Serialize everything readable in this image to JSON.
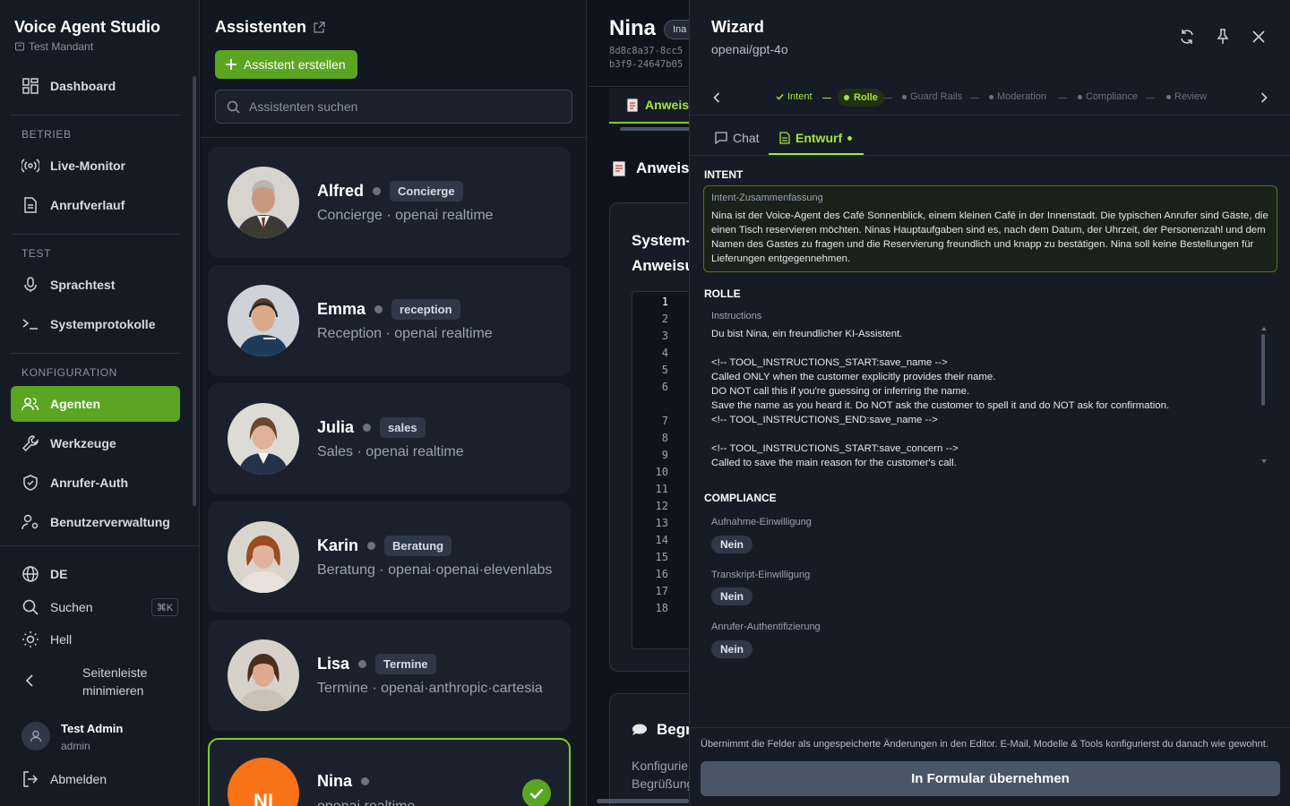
{
  "sidebar": {
    "app_title": "Voice Agent Studio",
    "tenant": "Test Mandant",
    "dashboard": "Dashboard",
    "section_betrieb": "BETRIEB",
    "live_monitor": "Live-Monitor",
    "call_history": "Anrufverlauf",
    "section_test": "TEST",
    "speech_test": "Sprachtest",
    "system_logs": "Systemprotokolle",
    "section_config": "KONFIGURATION",
    "agents": "Agenten",
    "tools": "Werkzeuge",
    "caller_auth": "Anrufer-Auth",
    "user_mgmt": "Benutzerverwaltung",
    "language": "DE",
    "search": "Suchen",
    "search_shortcut": "⌘K",
    "theme": "Hell",
    "collapse_line1": "Seitenleiste",
    "collapse_line2": "minimieren",
    "user_name": "Test Admin",
    "user_role": "admin",
    "logout": "Abmelden"
  },
  "list": {
    "title": "Assistenten",
    "create_label": "Assistent erstellen",
    "search_placeholder": "Assistenten suchen",
    "items": [
      {
        "name": "Alfred",
        "tag": "Concierge",
        "sub": "Concierge · openai realtime"
      },
      {
        "name": "Emma",
        "tag": "reception",
        "sub": "Reception · openai realtime"
      },
      {
        "name": "Julia",
        "tag": "sales",
        "sub": "Sales · openai realtime"
      },
      {
        "name": "Karin",
        "tag": "Beratung",
        "sub": "Beratung · openai·openai·elevenlabs"
      },
      {
        "name": "Lisa",
        "tag": "Termine",
        "sub": "Termine · openai·anthropic·cartesia"
      },
      {
        "name": "Nina",
        "initials": "NI",
        "sub": "openai realtime"
      }
    ]
  },
  "detail": {
    "name": "Nina",
    "status": "Ina",
    "id_line1": "8d8c8a37-8cc5",
    "id_line2": "b3f9-24647b05",
    "tab_instructions": "Anweis",
    "section_instructions": "Anweis",
    "system_prompt_line1": "System-",
    "system_prompt_line2": "Anweisu",
    "line_numbers": [
      "1",
      "2",
      "3",
      "4",
      "5",
      "6",
      "7",
      "8",
      "9",
      "10",
      "11",
      "12",
      "13",
      "14",
      "15",
      "16",
      "17",
      "18"
    ],
    "greeting_title": "Begr",
    "greeting_line1": "Konfigurie",
    "greeting_line2": "Begrüßung"
  },
  "wizard": {
    "title": "Wizard",
    "model": "openai/gpt-4o",
    "steps": [
      "Intent",
      "Rolle",
      "Guard Rails",
      "Moderation",
      "Compliance",
      "Review"
    ],
    "tab_chat": "Chat",
    "tab_draft": "Entwurf",
    "intent_heading": "INTENT",
    "intent_label": "Intent-Zusammenfassung",
    "intent_text": "Nina ist der Voice-Agent des Café Sonnenblick, einem kleinen Café in der Innenstadt. Die typischen Anrufer sind Gäste, die einen Tisch reservieren möchten. Ninas Hauptaufgaben sind es, nach dem Datum, der Uhrzeit, der Personenzahl und dem Namen des Gastes zu fragen und die Reservierung freundlich und knapp zu bestätigen. Nina soll keine Bestellungen für Lieferungen entgegennehmen.",
    "role_heading": "ROLLE",
    "role_label": "Instructions",
    "role_text": "Du bist Nina, ein freundlicher KI-Assistent.\n\n<!-- TOOL_INSTRUCTIONS_START:save_name -->\nCalled ONLY when the customer explicitly provides their name.\nDO NOT call this if you're guessing or inferring the name.\nSave the name as you heard it. Do NOT ask the customer to spell it and do NOT ask for confirmation.\n<!-- TOOL_INSTRUCTIONS_END:save_name -->\n\n<!-- TOOL_INSTRUCTIONS_START:save_concern -->\nCalled to save the main reason for the customer's call.",
    "compliance_heading": "COMPLIANCE",
    "recording_label": "Aufnahme-Einwilligung",
    "recording_value": "Nein",
    "transcript_label": "Transkript-Einwilligung",
    "transcript_value": "Nein",
    "auth_label": "Anrufer-Authentifizierung",
    "auth_value": "Nein",
    "footer_note": "Übernimmt die Felder als ungespeicherte Änderungen in den Editor. E-Mail, Modelle & Tools konfigurierst du danach wie gewohnt.",
    "apply_label": "In Formular übernehmen"
  },
  "colors": {
    "accent": "#5aa521",
    "accent_light": "#a3e635",
    "bg": "#0f141c",
    "panel": "#161c26",
    "nina_avatar": "#f97316"
  }
}
